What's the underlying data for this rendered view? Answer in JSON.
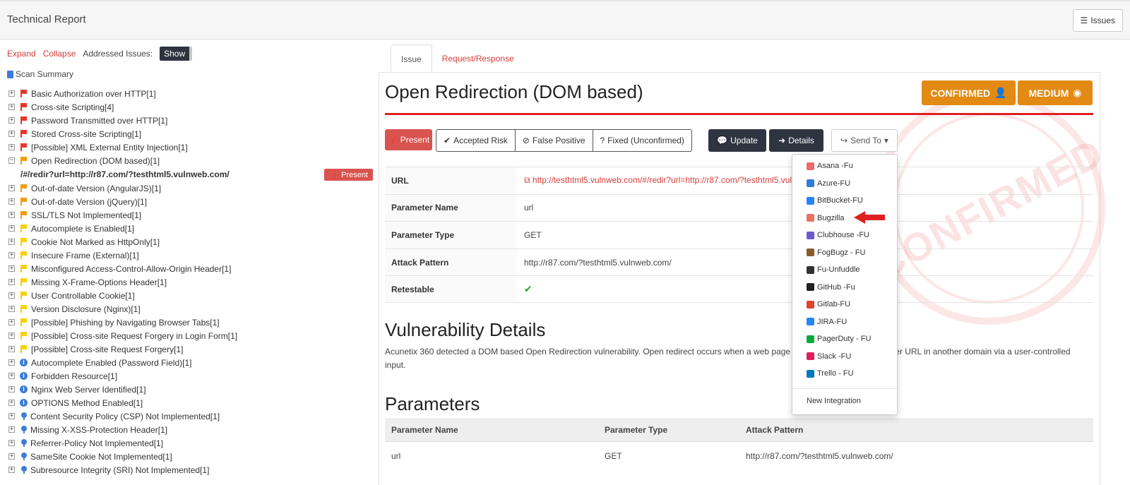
{
  "header": {
    "title": "Technical Report",
    "issues_label": "Issues"
  },
  "tree_controls": {
    "expand": "Expand",
    "collapse": "Collapse",
    "addressed_label": "Addressed Issues:",
    "show": "Show"
  },
  "scan_summary": "Scan Summary",
  "tree_items_before": [
    {
      "label": "Basic Authorization over HTTP[1]",
      "icon": "flag-red"
    },
    {
      "label": "Cross-site Scripting[4]",
      "icon": "flag-red"
    },
    {
      "label": "Password Transmitted over HTTP[1]",
      "icon": "flag-red"
    },
    {
      "label": "Stored Cross-site Scripting[1]",
      "icon": "flag-red"
    },
    {
      "label": "[Possible] XML External Entity Injection[1]",
      "icon": "flag-red"
    },
    {
      "label": "Open Redirection (DOM based)[1]",
      "icon": "flag-orange",
      "expanded": true
    }
  ],
  "selected_url": {
    "path": "/#/redir?url=http://r87.com/?testhtml5.vulnweb.com/",
    "status": "Present"
  },
  "tree_items_after": [
    {
      "label": "Out-of-date Version (AngularJS)[1]",
      "icon": "flag-orange"
    },
    {
      "label": "Out-of-date Version (jQuery)[1]",
      "icon": "flag-orange"
    },
    {
      "label": "SSL/TLS Not Implemented[1]",
      "icon": "flag-orange"
    },
    {
      "label": "Autocomplete is Enabled[1]",
      "icon": "flag-yellow"
    },
    {
      "label": "Cookie Not Marked as HttpOnly[1]",
      "icon": "flag-yellow"
    },
    {
      "label": "Insecure Frame (External)[1]",
      "icon": "flag-yellow"
    },
    {
      "label": "Misconfigured Access-Control-Allow-Origin Header[1]",
      "icon": "flag-yellow"
    },
    {
      "label": "Missing X-Frame-Options Header[1]",
      "icon": "flag-yellow"
    },
    {
      "label": "User Controllable Cookie[1]",
      "icon": "flag-yellow"
    },
    {
      "label": "Version Disclosure (Nginx)[1]",
      "icon": "flag-yellow"
    },
    {
      "label": "[Possible] Phishing by Navigating Browser Tabs[1]",
      "icon": "flag-yellow"
    },
    {
      "label": "[Possible] Cross-site Request Forgery in Login Form[1]",
      "icon": "flag-yellow"
    },
    {
      "label": "[Possible] Cross-site Request Forgery[1]",
      "icon": "flag-yellow"
    },
    {
      "label": "Autocomplete Enabled (Password Field)[1]",
      "icon": "info"
    },
    {
      "label": "Forbidden Resource[1]",
      "icon": "info"
    },
    {
      "label": "Nginx Web Server Identified[1]",
      "icon": "info"
    },
    {
      "label": "OPTIONS Method Enabled[1]",
      "icon": "info"
    },
    {
      "label": "Content Security Policy (CSP) Not Implemented[1]",
      "icon": "pin"
    },
    {
      "label": "Missing X-XSS-Protection Header[1]",
      "icon": "pin"
    },
    {
      "label": "Referrer-Policy Not Implemented[1]",
      "icon": "pin"
    },
    {
      "label": "SameSite Cookie Not Implemented[1]",
      "icon": "pin"
    },
    {
      "label": "Subresource Integrity (SRI) Not Implemented[1]",
      "icon": "pin"
    }
  ],
  "tabs": [
    "Issue",
    "Request/Response"
  ],
  "issue": {
    "title": "Open Redirection (DOM based)",
    "confirmed_badge": "CONFIRMED",
    "severity_badge": "MEDIUM",
    "stamp_text": "CONFIRMED"
  },
  "actions": {
    "present": "Present",
    "accepted_risk": "Accepted Risk",
    "false_positive": "False Positive",
    "fixed": "Fixed (Unconfirmed)",
    "update": "Update",
    "details": "Details",
    "send_to": "Send To"
  },
  "details": [
    {
      "key": "URL",
      "value": "http://testhtml5.vulnweb.com/#/redir?url=http://r87.com/?testhtml5.vulnweb.com/",
      "link": true
    },
    {
      "key": "Parameter Name",
      "value": "url"
    },
    {
      "key": "Parameter Type",
      "value": "GET"
    },
    {
      "key": "Attack Pattern",
      "value": "http://r87.com/?testhtml5.vulnweb.com/"
    },
    {
      "key": "Retestable",
      "value": "✔",
      "check": true
    }
  ],
  "vuln_details": {
    "heading": "Vulnerability Details",
    "text": "Acunetix 360 detected a DOM based Open Redirection vulnerability. Open redirect occurs when a web page is being redirected to another URL in another domain via a user-controlled input."
  },
  "parameters": {
    "heading": "Parameters",
    "columns": [
      "Parameter Name",
      "Parameter Type",
      "Attack Pattern"
    ],
    "rows": [
      [
        "url",
        "GET",
        "http://r87.com/?testhtml5.vulnweb.com/"
      ]
    ]
  },
  "send_to_menu": {
    "items": [
      {
        "label": "Asana -Fu",
        "icon": "asana-icon",
        "color": "#f06a6a"
      },
      {
        "label": "Azure-FU",
        "icon": "azure-icon",
        "color": "#2f7fd8"
      },
      {
        "label": "BitBucket-FU",
        "icon": "bitbucket-icon",
        "color": "#2684ff"
      },
      {
        "label": "Bugzilla",
        "icon": "bugzilla-icon",
        "color": "#e8735a"
      },
      {
        "label": "Clubhouse -FU",
        "icon": "clubhouse-icon",
        "color": "#6a5acd"
      },
      {
        "label": "FogBugz - FU",
        "icon": "fogbugz-icon",
        "color": "#8b5a2b"
      },
      {
        "label": "Fu-Unfuddle",
        "icon": "unfuddle-icon",
        "color": "#333333"
      },
      {
        "label": "GitHub -Fu",
        "icon": "github-icon",
        "color": "#222222"
      },
      {
        "label": "Gitlab-FU",
        "icon": "gitlab-icon",
        "color": "#e24329"
      },
      {
        "label": "JIRA-FU",
        "icon": "jira-icon",
        "color": "#2684ff"
      },
      {
        "label": "PagerDuty - FU",
        "icon": "pagerduty-icon",
        "color": "#06ac38"
      },
      {
        "label": "Slack -FU",
        "icon": "slack-icon",
        "color": "#e01e5a"
      },
      {
        "label": "Trello - FU",
        "icon": "trello-icon",
        "color": "#0079bf"
      }
    ],
    "new_integration": "New Integration"
  },
  "colors": {
    "accent_red": "#d43f3a",
    "badge_orange": "#e28a13",
    "dark_button": "#2e3440",
    "severity_line": "#e02020"
  }
}
